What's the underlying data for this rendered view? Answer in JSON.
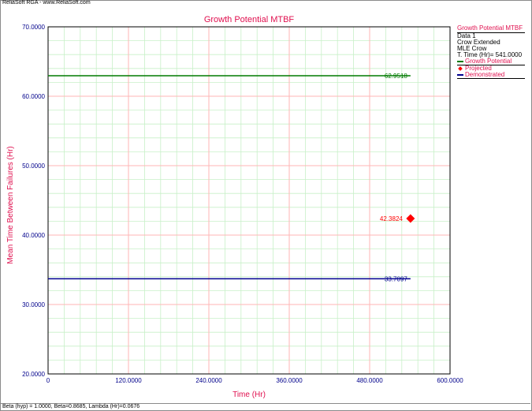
{
  "window": {
    "app_title": "ReliaSoft RGA - www.ReliaSoft.com",
    "footer_text": "Beta (hyp) = 1.0000, Beta=0.8685, Lambda (Hr)=0.0676"
  },
  "legend": {
    "title": "Growth Potential MTBF",
    "info": [
      "Data 1",
      "Crow Extended",
      "MLE Crow",
      "T. Time (Hr)= 541.0000"
    ],
    "items": [
      {
        "label": "Growth Potential",
        "color": "#007a00",
        "kind": "line"
      },
      {
        "label": "Projected",
        "color": "#ff0000",
        "kind": "diamond"
      },
      {
        "label": "Demonstrated",
        "color": "#000090",
        "kind": "line"
      }
    ]
  },
  "chart_data": {
    "type": "line",
    "title": "Growth Potential MTBF",
    "xlabel": "Time (Hr)",
    "ylabel": "Mean Time Between Failures (Hr)",
    "xlim": [
      0,
      600
    ],
    "ylim": [
      20,
      70
    ],
    "x_major_ticks": [
      0,
      120,
      240,
      360,
      480,
      600
    ],
    "y_major_ticks": [
      20,
      30,
      40,
      50,
      60,
      70
    ],
    "x_tick_labels": [
      "0",
      "120.0000",
      "240.0000",
      "360.0000",
      "480.0000",
      "600.0000"
    ],
    "y_tick_labels": [
      "20.0000",
      "30.0000",
      "40.0000",
      "50.0000",
      "60.0000",
      "70.0000"
    ],
    "grid": true,
    "colors": {
      "title": "#e0104f",
      "axis_label": "#e0104f",
      "tick": "#00008b",
      "major_grid": "#ffb6b6",
      "minor_grid": "#c8f0c8"
    },
    "series": [
      {
        "name": "Growth Potential",
        "kind": "hline",
        "x": [
          0,
          541
        ],
        "y": 62.9518,
        "color": "#007a00",
        "label": "62.9518"
      },
      {
        "name": "Projected",
        "kind": "point",
        "x": 541,
        "y": 42.3824,
        "color": "#ff0000",
        "label": "42.3824"
      },
      {
        "name": "Demonstrated",
        "kind": "hline",
        "x": [
          0,
          541
        ],
        "y": 33.7097,
        "color": "#000090",
        "label": "33.7097"
      }
    ]
  }
}
